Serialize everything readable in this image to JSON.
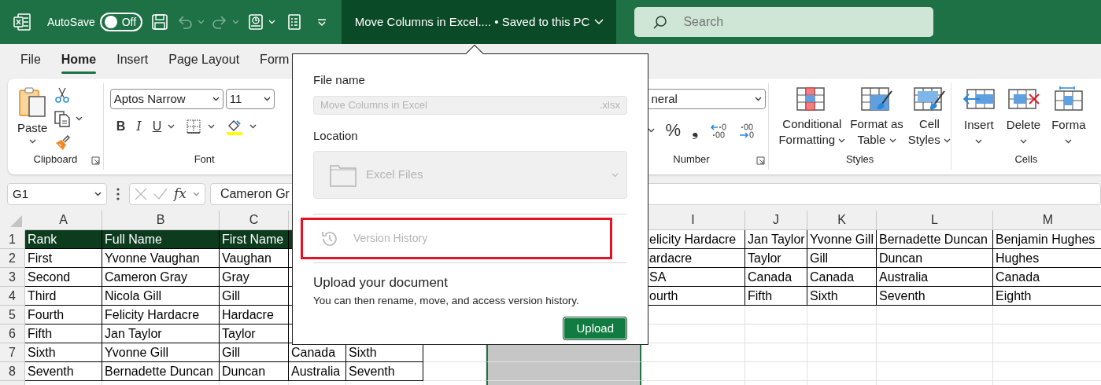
{
  "title_bar": {
    "autosave_label": "AutoSave",
    "autosave_toggle": {
      "label": "Off",
      "on": false
    },
    "quick_access": [
      {
        "kind": "save",
        "disabled": false,
        "dropdown": false
      },
      {
        "kind": "undo",
        "disabled": true,
        "dropdown": true
      },
      {
        "kind": "redo",
        "disabled": true,
        "dropdown": true
      },
      {
        "kind": "touch",
        "disabled": false,
        "dropdown": true
      },
      {
        "kind": "form",
        "disabled": false,
        "dropdown": false
      },
      {
        "kind": "customize",
        "disabled": false,
        "dropdown": false
      }
    ],
    "document_title": "Move Columns in Excel.... • Saved to this PC"
  },
  "search": {
    "placeholder": "Search"
  },
  "tabs": [
    {
      "label": "File",
      "selected": false
    },
    {
      "label": "Home",
      "selected": true
    },
    {
      "label": "Insert",
      "selected": false
    },
    {
      "label": "Page Layout",
      "selected": false
    },
    {
      "label": "Form",
      "selected": false
    }
  ],
  "ribbon": {
    "clipboard": {
      "label": "Clipboard",
      "launcher": true,
      "paste_label": "Paste",
      "tools": [
        {
          "kind": "cut",
          "dropdown": false
        },
        {
          "kind": "copy",
          "dropdown": true
        },
        {
          "kind": "format-painter",
          "dropdown": false
        }
      ]
    },
    "font": {
      "label": "Font",
      "font_name": "Aptos Narrow",
      "font_size": "11",
      "buttons": [
        {
          "kind": "bold",
          "text": "B",
          "dropdown": false
        },
        {
          "kind": "italic",
          "text": "I",
          "dropdown": false
        },
        {
          "kind": "underline",
          "text": "U",
          "dropdown": true
        },
        {
          "kind": "borders",
          "dropdown": true
        },
        {
          "kind": "fill-color",
          "dropdown": true
        }
      ]
    },
    "number": {
      "label": "Number",
      "launcher": true,
      "format": "neral",
      "buttons": [
        {
          "kind": "caret"
        },
        {
          "kind": "text",
          "text": "%"
        },
        {
          "kind": "text",
          "text": "❟"
        },
        {
          "kind": "increase-decimal"
        },
        {
          "kind": "decrease-decimal"
        }
      ]
    },
    "styles": {
      "label": "Styles",
      "commands": [
        {
          "kind": "conditional",
          "lines": [
            "Conditional",
            "Formatting"
          ]
        },
        {
          "kind": "table",
          "lines": [
            "Format as",
            "Table"
          ]
        },
        {
          "kind": "cell-styles",
          "lines": [
            "Cell",
            "Styles"
          ]
        }
      ]
    },
    "cells": {
      "label": "Cells",
      "commands": [
        {
          "kind": "insert",
          "label": "Insert"
        },
        {
          "kind": "delete",
          "label": "Delete"
        },
        {
          "kind": "format",
          "label": "Forma"
        }
      ]
    }
  },
  "formula_bar": {
    "name_box": "G1",
    "fx": "fx",
    "formula": "Cameron Gr"
  },
  "sheet": {
    "left": {
      "columns": [
        {
          "label": "A",
          "selected": false
        },
        {
          "label": "B",
          "selected": false
        },
        {
          "label": "C",
          "selected": false
        },
        {
          "selected": false
        },
        {
          "selected": false
        },
        {
          "selected": false
        },
        {
          "selected": true
        }
      ],
      "rows": [
        {
          "number": "1",
          "kind": "header",
          "cells": [
            "Rank",
            "Full Name",
            "First Name"
          ]
        },
        {
          "number": "2",
          "kind": "data",
          "cells": [
            "First",
            "Yvonne Vaughan",
            "Vaughan"
          ]
        },
        {
          "number": "3",
          "kind": "data",
          "cells": [
            "Second",
            "Cameron Gray",
            "Gray"
          ]
        },
        {
          "number": "4",
          "kind": "data",
          "cells": [
            "Third",
            "Nicola Gill",
            "Gill"
          ]
        },
        {
          "number": "5",
          "kind": "data",
          "cells": [
            "Fourth",
            "Felicity Hardacre",
            "Hardacre"
          ]
        },
        {
          "number": "6",
          "kind": "data",
          "cells": [
            "Fifth",
            "Jan Taylor",
            "Taylor"
          ]
        },
        {
          "number": "7",
          "kind": "data",
          "cells": [
            "Sixth",
            "Yvonne Gill",
            "Gill",
            "Canada",
            "Sixth"
          ]
        },
        {
          "number": "8",
          "kind": "data",
          "cells": [
            "Seventh",
            "Bernadette Duncan",
            "Duncan",
            "Australia",
            "Seventh"
          ]
        }
      ]
    },
    "right": {
      "columns": [
        {
          "label": "I",
          "selected": false
        },
        {
          "label": "J",
          "selected": false
        },
        {
          "label": "K",
          "selected": false
        },
        {
          "label": "L",
          "selected": false
        },
        {
          "label": "M",
          "selected": false
        }
      ],
      "rows": [
        {
          "cells": [
            "elicity Hardacre",
            "Jan Taylor",
            "Yvonne Gill",
            "Bernadette Duncan",
            "Benjamin Hughes"
          ]
        },
        {
          "cells": [
            "ardacre",
            "Taylor",
            "Gill",
            "Duncan",
            "Hughes"
          ]
        },
        {
          "cells": [
            "SA",
            "Canada",
            "Canada",
            "Australia",
            "Canada"
          ]
        },
        {
          "cells": [
            "ourth",
            "Fifth",
            "Sixth",
            "Seventh",
            "Eighth"
          ]
        }
      ]
    }
  },
  "save_popup": {
    "file_name_label": "File name",
    "file_name": "Move Columns in Excel",
    "extension": ".xlsx",
    "location_label": "Location",
    "location": "Excel Files",
    "version_history": {
      "label": "Version History",
      "disabled": true,
      "highlighted": true
    },
    "upload_title": "Upload your document",
    "upload_text": "You can then rename, move, and access version history.",
    "upload_button": "Upload"
  }
}
